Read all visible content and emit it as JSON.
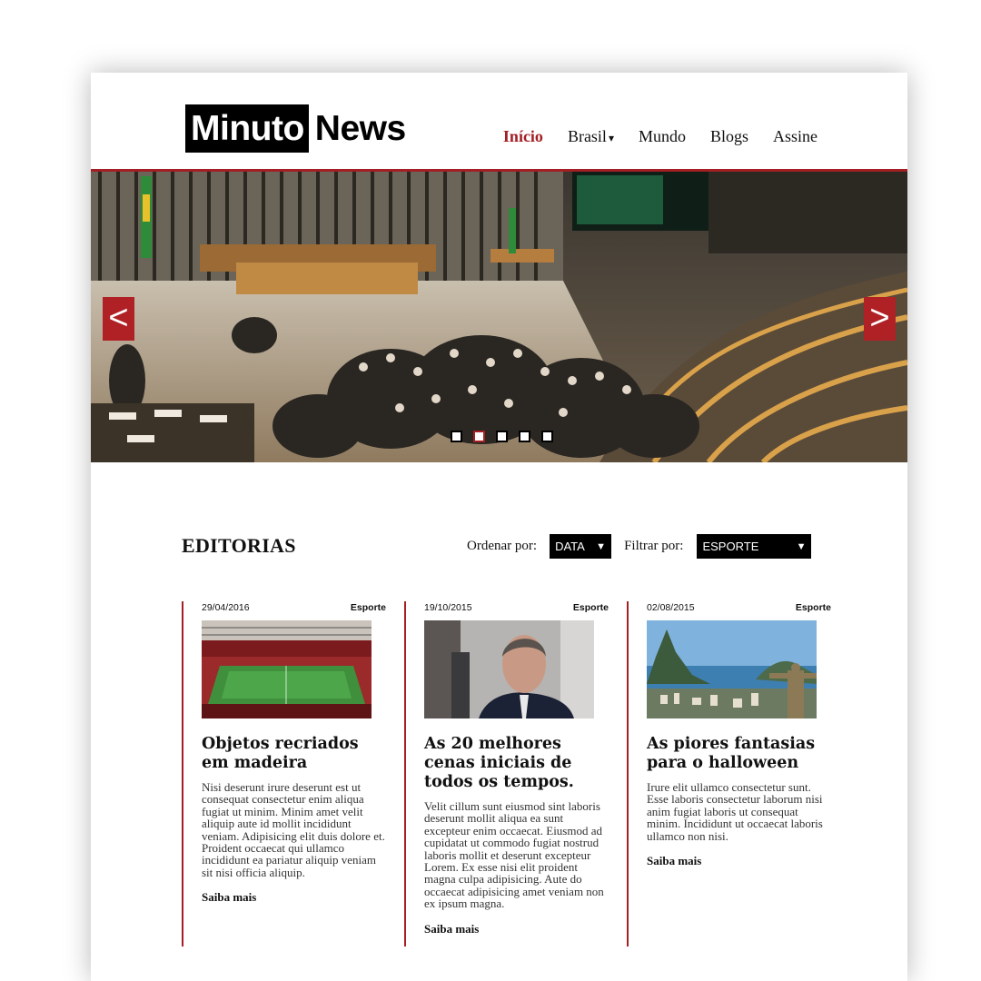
{
  "brand": {
    "logo_part1": "Minuto",
    "logo_part2": "News"
  },
  "nav": [
    {
      "label": "Início",
      "active": true
    },
    {
      "label": "Brasil"
    },
    {
      "label": "Mundo"
    },
    {
      "label": "Blogs"
    },
    {
      "label": "Assine"
    }
  ],
  "nav_brasil_caret": "▾",
  "hero": {
    "prev": "<",
    "next": ">",
    "slide_count": 5,
    "active_slide": 1
  },
  "section": {
    "title": "EDITORIAS",
    "sort_label": "Ordenar por:",
    "sort_value": "DATA",
    "filter_label": "Filtrar por:",
    "filter_value": "ESPORTE",
    "select_arrow": "▼"
  },
  "cards": [
    {
      "date": "29/04/2016",
      "category": "Esporte",
      "image": "stadium-photo",
      "title": "Objetos recriados em madeira",
      "body": "Nisi deserunt irure deserunt est ut consequat consectetur enim aliqua fugiat ut minim. Minim amet velit aliquip aute id mollit incididunt veniam. Adipisicing elit duis dolore et. Proident occaecat qui ullamco incididunt ea pariatur aliquip veniam sit nisi officia aliquip.",
      "more": "Saiba mais"
    },
    {
      "date": "19/10/2015",
      "category": "Esporte",
      "image": "politician-portrait-photo",
      "title": "As 20 melhores cenas iniciais de todos os tempos.",
      "body": "Velit cillum sunt eiusmod sint laboris deserunt mollit aliqua ea sunt excepteur enim occaecat. Eiusmod ad cupidatat ut commodo fugiat nostrud laboris mollit et deserunt excepteur Lorem. Ex esse nisi elit proident magna culpa adipisicing. Aute do occaecat adipisicing amet veniam non ex ipsum magna.",
      "more": "Saiba mais"
    },
    {
      "date": "02/08/2015",
      "category": "Esporte",
      "image": "rio-de-janeiro-photo",
      "title": "As piores fantasias para o halloween",
      "body": "Irure elit ullamco consectetur sunt. Esse laboris consectetur laborum nisi anim fugiat laboris ut consequat minim. Incididunt ut occaecat laboris ullamco non nisi.",
      "more": "Saiba mais"
    }
  ],
  "colors": {
    "accent": "#a31f24",
    "arrow_bg": "#b02126",
    "select_bg": "#000000"
  }
}
